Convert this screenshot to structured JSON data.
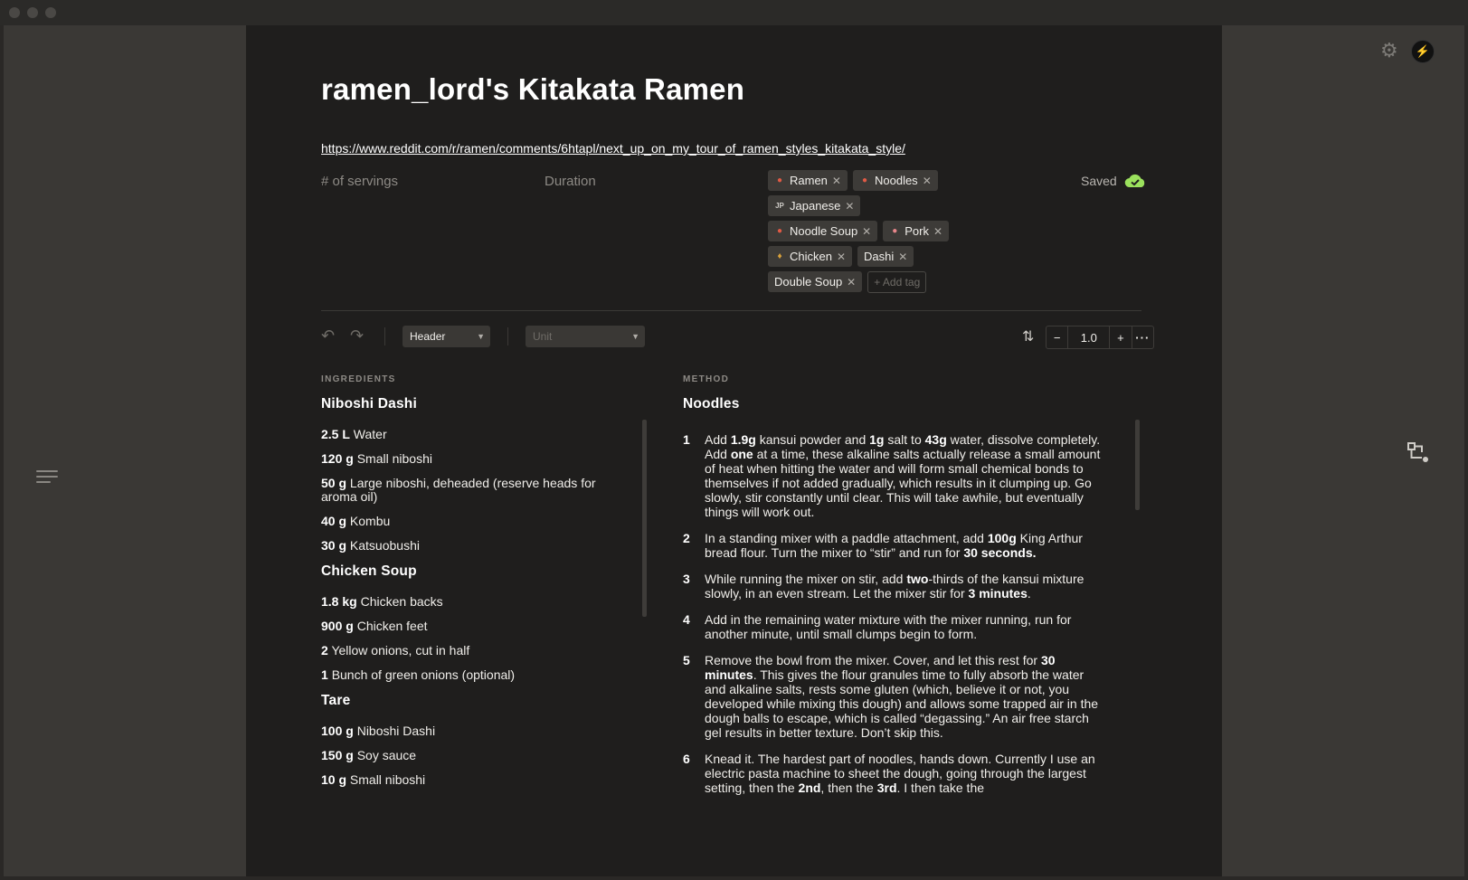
{
  "recipe": {
    "title": "ramen_lord's Kitakata Ramen",
    "source_url": "https://www.reddit.com/r/ramen/comments/6htapl/next_up_on_my_tour_of_ramen_styles_kitakata_style/",
    "servings_placeholder": "# of servings",
    "duration_placeholder": "Duration",
    "save_status": "Saved"
  },
  "tags": {
    "rows": [
      [
        {
          "label": "Ramen",
          "icon": "noodle-bowl-icon"
        },
        {
          "label": "Noodles",
          "icon": "noodle-bowl-icon"
        }
      ],
      [
        {
          "label": "Japanese",
          "icon": "jp-flag-icon",
          "emoji": "JP"
        }
      ],
      [
        {
          "label": "Noodle Soup",
          "icon": "noodle-bowl-icon"
        },
        {
          "label": "Pork",
          "icon": "pig-icon"
        }
      ],
      [
        {
          "label": "Chicken",
          "icon": "rooster-icon"
        },
        {
          "label": "Dashi"
        }
      ],
      [
        {
          "label": "Double Soup"
        }
      ]
    ],
    "add_placeholder": "+ Add tag",
    "remove_glyph": "✕"
  },
  "toolbar": {
    "block_type": "Header",
    "unit_placeholder": "Unit",
    "scale_value": "1.0",
    "decrement": "−",
    "increment": "+",
    "more": "···"
  },
  "ingredients": {
    "section_label": "INGREDIENTS",
    "groups": [
      {
        "name": "Niboshi Dashi",
        "items": [
          {
            "qty": "2.5 L",
            "name": "Water"
          },
          {
            "qty": "120 g",
            "name": "Small niboshi"
          },
          {
            "qty": "50 g",
            "name": "Large niboshi, deheaded (reserve heads for aroma oil)"
          },
          {
            "qty": "40 g",
            "name": "Kombu"
          },
          {
            "qty": "30 g",
            "name": "Katsuobushi"
          }
        ]
      },
      {
        "name": "Chicken Soup",
        "items": [
          {
            "qty": "1.8 kg",
            "name": "Chicken backs"
          },
          {
            "qty": "900 g",
            "name": "Chicken feet"
          },
          {
            "qty": "2",
            "name": "Yellow onions, cut in half"
          },
          {
            "qty": "1",
            "name": "Bunch of green onions (optional)"
          }
        ]
      },
      {
        "name": "Tare",
        "items": [
          {
            "qty": "100 g",
            "name": "Niboshi Dashi"
          },
          {
            "qty": "150 g",
            "name": "Soy sauce"
          },
          {
            "qty": "10 g",
            "name": "Small niboshi"
          }
        ]
      }
    ]
  },
  "method": {
    "section_label": "METHOD",
    "title": "Noodles",
    "steps": [
      {
        "num": "1",
        "html": "Add <b>1.9g</b> kansui powder and <b>1g</b> salt to <b>43g</b> water, dissolve completely. Add <b>one</b> at a time, these alkaline salts actually release a small amount of heat when hitting the water and will form small chemical bonds to themselves if not added gradually, which results in it clumping up. Go slowly, stir constantly until clear. This will take awhile, but eventually things will work out."
      },
      {
        "num": "2",
        "html": "In a standing mixer with a paddle attachment, add <b>100g</b> King Arthur bread flour. Turn the mixer to “stir” and run for <b>30 seconds.</b>"
      },
      {
        "num": "3",
        "html": "While running the mixer on stir, add <b>two</b>-thirds of the kansui mixture slowly, in an even stream. Let the mixer stir for <b>3 minutes</b>."
      },
      {
        "num": "4",
        "html": "Add in the remaining water mixture with the mixer running, run for another minute, until small clumps begin to form."
      },
      {
        "num": "5",
        "html": "Remove the bowl from the mixer. Cover, and let this rest for <b>30 minutes</b>. This gives the flour granules time to fully absorb the water and alkaline salts, rests some gluten (which, believe it or not, you developed while mixing this dough) and allows some trapped air in the dough balls to escape, which is called “degassing.” An air free starch gel results in better texture. Don’t skip this."
      },
      {
        "num": "6",
        "html": "Knead it. The hardest part of noodles, hands down. Currently I use an electric pasta machine to sheet the dough, going through the largest setting, then the <b>2nd</b>, then the <b>3rd</b>. I then take the"
      }
    ]
  },
  "colors": {
    "accent_green": "#9be15d",
    "main_bg": "#1f1e1d",
    "side_bg": "#3a3835",
    "tag_bg": "#3d3b38"
  }
}
